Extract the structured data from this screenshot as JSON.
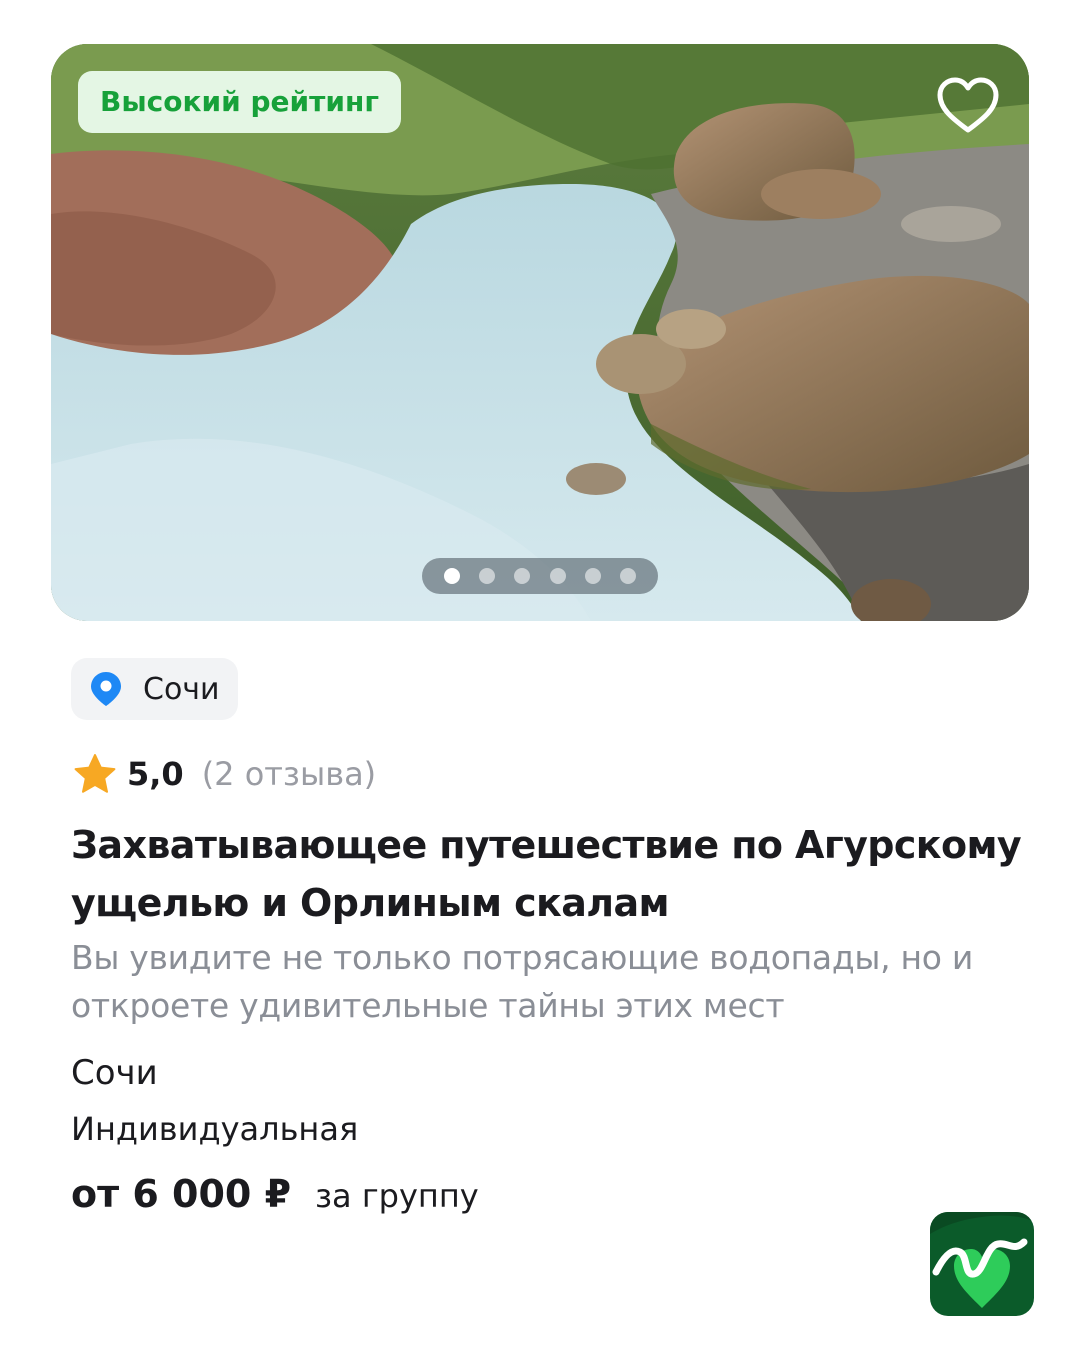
{
  "card": {
    "badge": "Высокий рейтинг",
    "favorite_icon": "heart-outline-icon",
    "gallery": {
      "total_images": 6,
      "active_index": 0
    },
    "location_chip": {
      "icon": "map-pin-icon",
      "label": "Сочи"
    },
    "rating": {
      "icon": "star-icon",
      "score": "5,0",
      "reviews": "(2 отзыва)"
    },
    "title": "Захватывающее путешествие по Агурскому ущелью и Орлиным скалам",
    "description": "Вы увидите не только потрясающие водопады, но и откроете удивительные тайны этих мест",
    "city": "Сочи",
    "format": "Индивидуальная",
    "price": {
      "amount": "от 6 000 ₽",
      "unit": "за группу"
    }
  },
  "colors": {
    "badge_text": "#17a13a",
    "badge_bg": "#e4f6e4",
    "pin": "#1e88f5",
    "star": "#f7a823",
    "muted_text": "#8a8e96",
    "logo_bg": "#0b5b2a",
    "logo_accent": "#2ecc5a"
  },
  "app_logo": {
    "icon": "app-logo-icon"
  }
}
